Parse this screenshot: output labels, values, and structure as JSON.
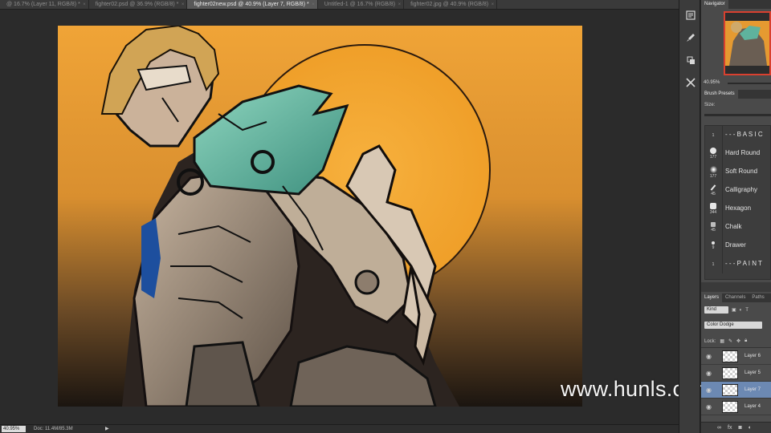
{
  "tabs": [
    {
      "label": "@ 16.7% (Layer 11, RGB/8) *",
      "active": false
    },
    {
      "label": "fighter02.psd @ 36.9% (RGB/8) *",
      "active": false
    },
    {
      "label": "fighter02new.psd @ 40.9% (Layer 7, RGB/8) *",
      "active": true
    },
    {
      "label": "Untitled-1 @ 16.7% (RGB/8)",
      "active": false
    },
    {
      "label": "fighter02.jpg @ 40.9% (RGB/8)",
      "active": false
    }
  ],
  "status": {
    "zoom": "40.95%",
    "doc": "Doc: 11.4M/85.3M"
  },
  "watermark": "www.hunls.com",
  "navigator": {
    "tab": "Navigator",
    "zoom": "40.95%"
  },
  "brush_presets": {
    "tab": "Brush Presets",
    "size_label": "Size:",
    "items": [
      {
        "name": "- - - B A S I C",
        "num": "1",
        "kind": "header"
      },
      {
        "name": "Hard Round",
        "num": "177",
        "kind": "hard"
      },
      {
        "name": "Soft Round",
        "num": "177",
        "kind": "soft"
      },
      {
        "name": "Calligraphy",
        "num": "45",
        "kind": "calli"
      },
      {
        "name": "Hexagon",
        "num": "344",
        "kind": "hex"
      },
      {
        "name": "Chalk",
        "num": "45",
        "kind": "chalk"
      },
      {
        "name": "Drawer",
        "num": "9",
        "kind": "drawer"
      },
      {
        "name": "- - - P A I N T",
        "num": "1",
        "kind": "header"
      }
    ]
  },
  "layers_panel": {
    "tabs": [
      "Layers",
      "Channels",
      "Paths"
    ],
    "filter": "Kind",
    "blend_mode": "Color Dodge",
    "lock_label": "Lock:",
    "layers": [
      {
        "name": "Layer 6",
        "selected": false
      },
      {
        "name": "Layer 5",
        "selected": false
      },
      {
        "name": "Layer 7",
        "selected": true
      },
      {
        "name": "Layer 4",
        "selected": false
      }
    ],
    "footer_icons": [
      "link-icon",
      "fx-icon",
      "mask-icon",
      "adjustment-icon"
    ]
  },
  "toolstrip_icons": [
    "history-icon",
    "brush-icon",
    "clone-source-icon",
    "stamp-icon",
    "tools-icon"
  ],
  "colors": {
    "accent_selection": "#6c89b3",
    "navigator_frame": "#d9402f",
    "sun": "#f1a02c"
  }
}
